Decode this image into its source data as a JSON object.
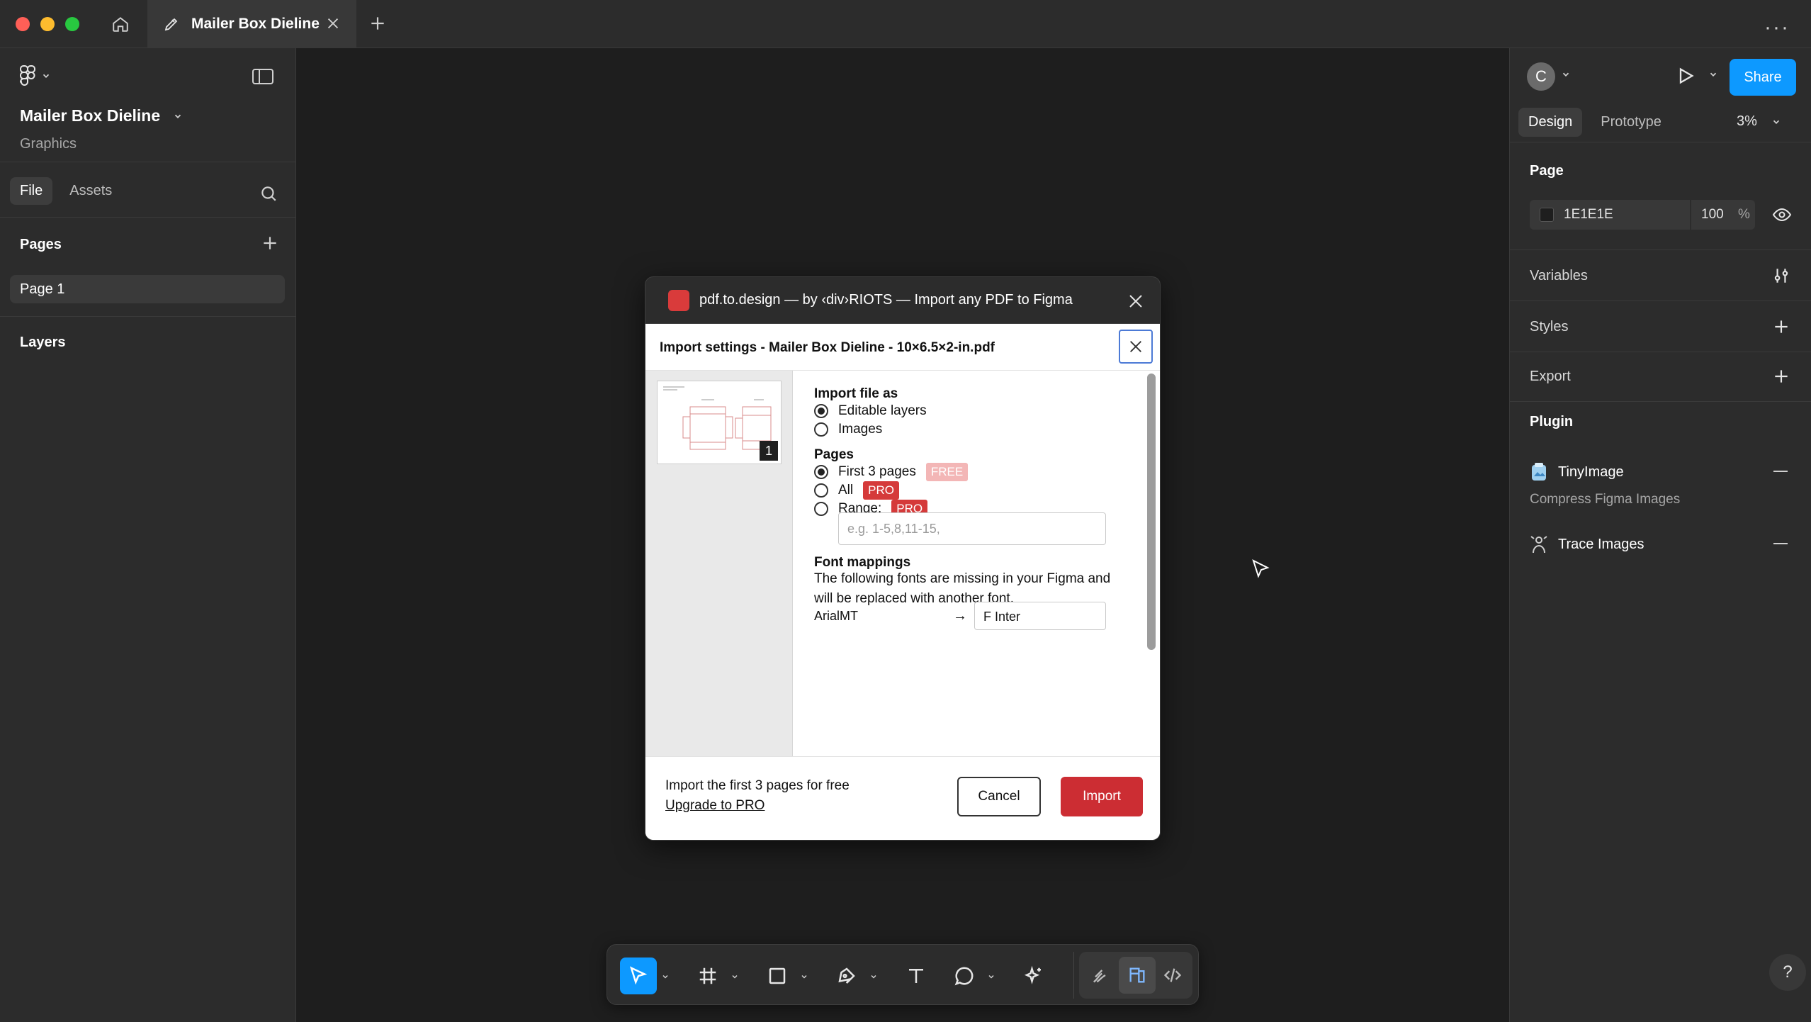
{
  "tab": {
    "title": "Mailer Box Dieline"
  },
  "left_panel": {
    "file_name": "Mailer Box Dieline",
    "project": "Graphics",
    "tabs": [
      "File",
      "Assets"
    ],
    "pages_header": "Pages",
    "pages": [
      "Page 1"
    ],
    "layers_header": "Layers"
  },
  "right_panel": {
    "avatar_initial": "C",
    "share_label": "Share",
    "tabs": [
      "Design",
      "Prototype"
    ],
    "zoom": "3%",
    "page_section": "Page",
    "page_color": "1E1E1E",
    "page_opacity": "100",
    "opacity_unit": "%",
    "variables": "Variables",
    "styles": "Styles",
    "export": "Export",
    "plugin_section": "Plugin",
    "plugins": [
      {
        "name": "TinyImage",
        "description": "Compress Figma Images"
      },
      {
        "name": "Trace Images"
      }
    ],
    "help": "?"
  },
  "dialog": {
    "title": "pdf.to.design — by ‹div›RIOTS — Import any PDF to Figma",
    "settings_title": "Import settings - Mailer Box Dieline - 10×6.5×2-in.pdf",
    "thumb_page_number": "1",
    "import_as_header": "Import file as",
    "import_as_options": [
      "Editable layers",
      "Images"
    ],
    "pages_header": "Pages",
    "page_options": [
      {
        "label": "First 3 pages",
        "badge": "FREE"
      },
      {
        "label": "All",
        "badge": "PRO"
      },
      {
        "label": "Range:",
        "badge": "PRO"
      }
    ],
    "range_placeholder": "e.g. 1-5,8,11-15,",
    "font_header": "Font mappings",
    "font_text": "The following fonts are missing in your Figma and will be replaced with another font.",
    "font_source": "ArialMT",
    "font_arrow": "→",
    "font_target": "F  Inter",
    "footer_text": "Import the first 3 pages for free",
    "upgrade_link": "Upgrade to PRO",
    "cancel": "Cancel",
    "import": "Import"
  },
  "colors": {
    "accent": "#0d99ff",
    "import_red": "#cc2d33",
    "pro_badge": "#d53a3a",
    "canvas": "#1e1e1e"
  }
}
